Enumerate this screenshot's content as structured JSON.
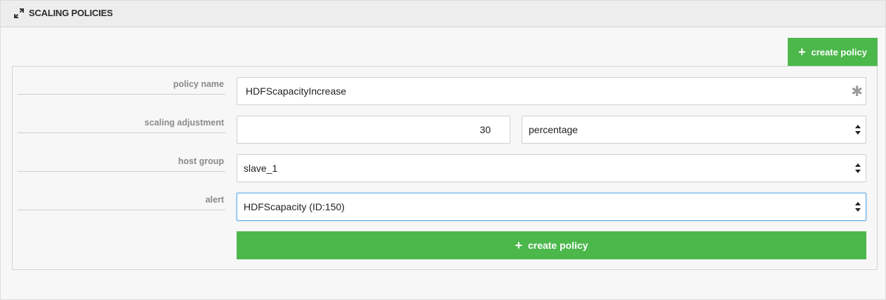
{
  "header": {
    "title": "SCALING POLICIES",
    "icon": "expand-icon"
  },
  "actions": {
    "top_create_label": "create policy",
    "bottom_create_label": "create policy",
    "plus_glyph": "+",
    "accent_color": "#4cb84c"
  },
  "form": {
    "policy_name": {
      "label": "policy name",
      "value": "HDFScapacityIncrease",
      "required_glyph": "✱"
    },
    "scaling_adjustment": {
      "label": "scaling adjustment",
      "value": "30",
      "unit": "percentage"
    },
    "host_group": {
      "label": "host group",
      "value": "slave_1"
    },
    "alert": {
      "label": "alert",
      "value": "HDFScapacity (ID:150)"
    }
  }
}
